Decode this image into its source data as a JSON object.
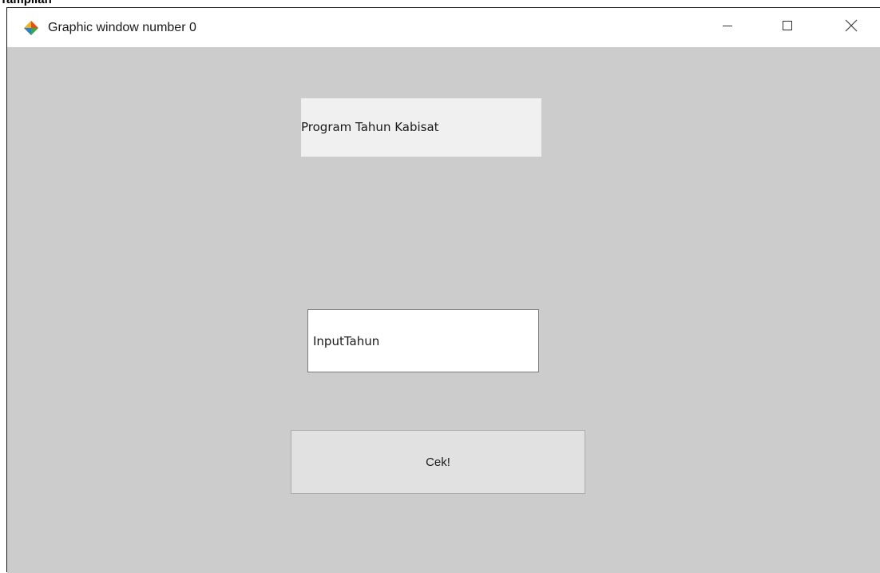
{
  "document": {
    "caption": "Tampilan"
  },
  "window": {
    "title": "Graphic window number 0",
    "icon": "scilab-diamond-icon",
    "controls": {
      "minimize_icon": "minimize-icon",
      "maximize_icon": "maximize-icon",
      "close_icon": "close-icon"
    }
  },
  "app": {
    "title_label": "Program Tahun Kabisat",
    "year_input": {
      "value": "InputTahun"
    },
    "check_button_label": "Cek!"
  },
  "colors": {
    "content_background": "#cccccc",
    "label_background": "#f0f0f0",
    "button_background": "#e1e1e1"
  }
}
